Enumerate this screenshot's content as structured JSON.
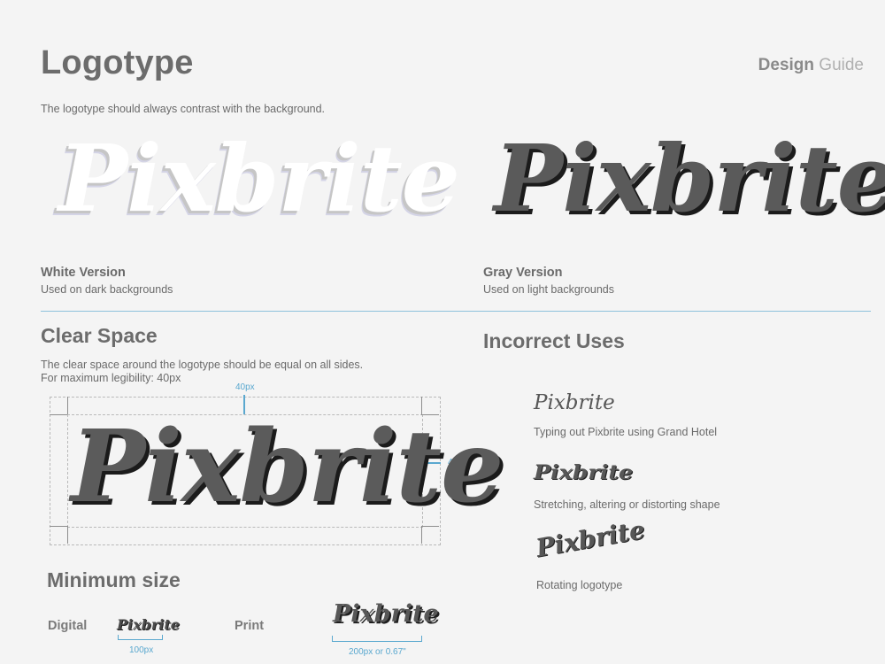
{
  "header": {
    "title": "Logotype",
    "brand_bold": "Design",
    "brand_light": "Guide",
    "intro": "The logotype should always contrast with the background."
  },
  "logo_text": "Pixbrite",
  "versions": {
    "white": {
      "label": "White Version",
      "desc": "Used on dark backgrounds"
    },
    "gray": {
      "label": "Gray Version",
      "desc": "Used on light backgrounds"
    }
  },
  "clear_space": {
    "title": "Clear Space",
    "line1": "The clear space around the logotype should be equal on all sides.",
    "line2": "For maximum legibility: 40px",
    "top_measure": "40px",
    "right_measure": "40px"
  },
  "incorrect": {
    "title": "Incorrect Uses",
    "items": [
      {
        "desc": "Typing out Pixbrite using Grand Hotel"
      },
      {
        "desc": "Stretching, altering or distorting shape"
      },
      {
        "desc": "Rotating logotype"
      }
    ]
  },
  "minimum": {
    "title": "Minimum size",
    "digital_label": "Digital",
    "digital_size": "100px",
    "print_label": "Print",
    "print_size": "200px or 0.67\""
  },
  "colors": {
    "background": "#f4f4f4",
    "heading": "#6c6c6c",
    "accent_blue": "#5aa8cf",
    "logo_gray": "#5a5a5a",
    "logo_shadow": "#1b1b1b"
  }
}
